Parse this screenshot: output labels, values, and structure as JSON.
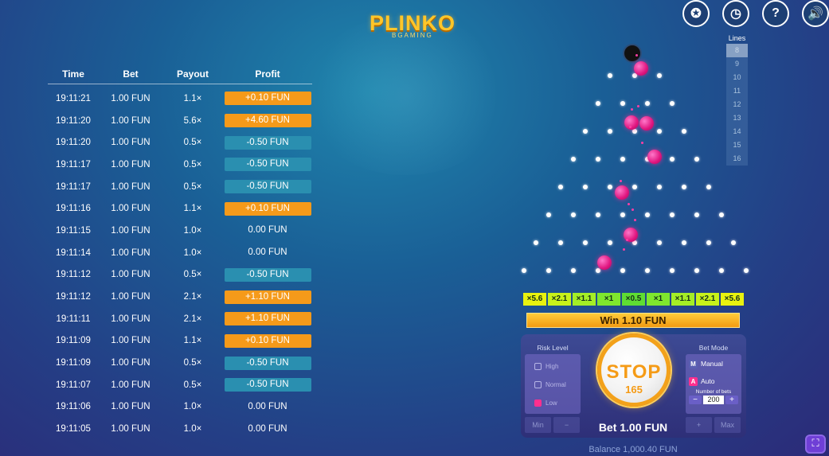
{
  "logo": {
    "title": "PLINKO",
    "subtitle": "BGAMING"
  },
  "top_icons": [
    {
      "name": "achievements-icon",
      "glyph": "✪"
    },
    {
      "name": "history-icon",
      "glyph": "◷"
    },
    {
      "name": "help-icon",
      "glyph": "?"
    },
    {
      "name": "sound-icon",
      "glyph": "🔊"
    }
  ],
  "history": {
    "headers": {
      "time": "Time",
      "bet": "Bet",
      "payout": "Payout",
      "profit": "Profit"
    },
    "rows": [
      {
        "time": "19:11:21",
        "bet": "1.00 FUN",
        "payout": "1.1×",
        "profit": "+0.10 FUN",
        "kind": "win"
      },
      {
        "time": "19:11:20",
        "bet": "1.00 FUN",
        "payout": "5.6×",
        "profit": "+4.60 FUN",
        "kind": "win"
      },
      {
        "time": "19:11:20",
        "bet": "1.00 FUN",
        "payout": "0.5×",
        "profit": "-0.50 FUN",
        "kind": "loss"
      },
      {
        "time": "19:11:17",
        "bet": "1.00 FUN",
        "payout": "0.5×",
        "profit": "-0.50 FUN",
        "kind": "loss"
      },
      {
        "time": "19:11:17",
        "bet": "1.00 FUN",
        "payout": "0.5×",
        "profit": "-0.50 FUN",
        "kind": "loss"
      },
      {
        "time": "19:11:16",
        "bet": "1.00 FUN",
        "payout": "1.1×",
        "profit": "+0.10 FUN",
        "kind": "win"
      },
      {
        "time": "19:11:15",
        "bet": "1.00 FUN",
        "payout": "1.0×",
        "profit": "0.00 FUN",
        "kind": "zero"
      },
      {
        "time": "19:11:14",
        "bet": "1.00 FUN",
        "payout": "1.0×",
        "profit": "0.00 FUN",
        "kind": "zero"
      },
      {
        "time": "19:11:12",
        "bet": "1.00 FUN",
        "payout": "0.5×",
        "profit": "-0.50 FUN",
        "kind": "loss"
      },
      {
        "time": "19:11:12",
        "bet": "1.00 FUN",
        "payout": "2.1×",
        "profit": "+1.10 FUN",
        "kind": "win"
      },
      {
        "time": "19:11:11",
        "bet": "1.00 FUN",
        "payout": "2.1×",
        "profit": "+1.10 FUN",
        "kind": "win"
      },
      {
        "time": "19:11:09",
        "bet": "1.00 FUN",
        "payout": "1.1×",
        "profit": "+0.10 FUN",
        "kind": "win"
      },
      {
        "time": "19:11:09",
        "bet": "1.00 FUN",
        "payout": "0.5×",
        "profit": "-0.50 FUN",
        "kind": "loss"
      },
      {
        "time": "19:11:07",
        "bet": "1.00 FUN",
        "payout": "0.5×",
        "profit": "-0.50 FUN",
        "kind": "loss"
      },
      {
        "time": "19:11:06",
        "bet": "1.00 FUN",
        "payout": "1.0×",
        "profit": "0.00 FUN",
        "kind": "zero"
      },
      {
        "time": "19:11:05",
        "bet": "1.00 FUN",
        "payout": "1.0×",
        "profit": "0.00 FUN",
        "kind": "zero"
      }
    ]
  },
  "lines": {
    "title": "Lines",
    "options": [
      "8",
      "9",
      "10",
      "11",
      "12",
      "13",
      "14",
      "15",
      "16"
    ],
    "selected": "8"
  },
  "multipliers": [
    {
      "label": "×5.6",
      "color": "#e9f20f"
    },
    {
      "label": "×2.1",
      "color": "#c8f21a"
    },
    {
      "label": "×1.1",
      "color": "#a4ee26"
    },
    {
      "label": "×1",
      "color": "#7fe62e"
    },
    {
      "label": "×0.5",
      "color": "#5fdd33"
    },
    {
      "label": "×1",
      "color": "#7fe62e"
    },
    {
      "label": "×1.1",
      "color": "#a4ee26"
    },
    {
      "label": "×2.1",
      "color": "#c8f21a"
    },
    {
      "label": "×5.6",
      "color": "#e9f20f"
    }
  ],
  "win_banner": "Win 1.10 FUN",
  "risk": {
    "title": "Risk Level",
    "options": [
      {
        "label": "High",
        "active": false
      },
      {
        "label": "Normal",
        "active": false
      },
      {
        "label": "Low",
        "active": true
      }
    ]
  },
  "stop": {
    "label": "STOP",
    "count": "165"
  },
  "bet_mode": {
    "title": "Bet Mode",
    "manual": {
      "key": "M",
      "label": "Manual"
    },
    "auto": {
      "key": "A",
      "label": "Auto"
    },
    "number_of_bets_label": "Number of bets",
    "number_of_bets": "200",
    "minus": "−",
    "plus": "+"
  },
  "bet_controls": {
    "min": "Min",
    "minus": "−",
    "plus": "+",
    "max": "Max"
  },
  "bet": "Bet 1.00 FUN",
  "balance": "Balance 1,000.40 FUN",
  "board": {
    "rows": 8,
    "accent_ball": "#e0157f"
  }
}
